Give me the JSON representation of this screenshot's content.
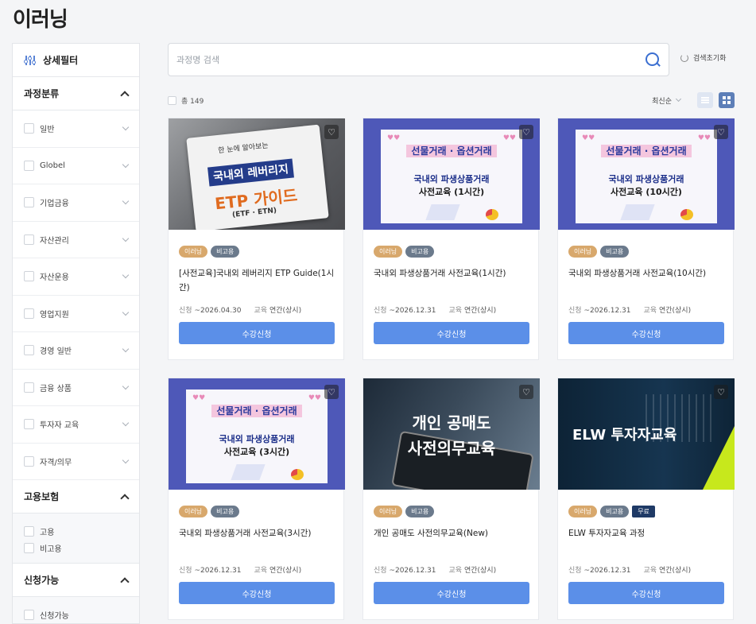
{
  "page": {
    "title": "이러닝"
  },
  "sidebar": {
    "header": "상세필터",
    "sections": [
      {
        "title": "과정분류",
        "items": [
          "일반",
          "Globel",
          "기업금융",
          "자산관리",
          "자산운용",
          "영업지원",
          "경영 일반",
          "금융 상품",
          "투자자 교육",
          "자격/의무"
        ]
      },
      {
        "title": "고용보험",
        "items": [
          "고용",
          "비고용"
        ]
      },
      {
        "title": "신청가능",
        "items": [
          "신청가능"
        ]
      }
    ]
  },
  "search": {
    "placeholder": "과정명 검색",
    "value": "",
    "reset_label": "검색초기화"
  },
  "toolbar": {
    "total_label": "총 149",
    "sort_label": "최신순"
  },
  "cards": [
    {
      "thumb": "etp",
      "thumb_text": [
        "한 눈에 알아보는",
        "국내외 레버리지",
        "ETP 가이드",
        "(ETF · ETN)"
      ],
      "badges": [
        "이러닝",
        "비고용"
      ],
      "title": "[사전교육]국내외 레버리지 ETP Guide(1시간)",
      "apply_label": "신청",
      "apply_period": "~2026.04.30",
      "edu_label": "교육",
      "edu_period": "연간(상시)",
      "button": "수강신청"
    },
    {
      "thumb": "deriv",
      "thumb_text": [
        "선물거래 · 옵션거래",
        "국내외 파생상품거래",
        "사전교육 (1시간)"
      ],
      "badges": [
        "이러닝",
        "비고용"
      ],
      "title": "국내외 파생상품거래 사전교육(1시간)",
      "apply_label": "신청",
      "apply_period": "~2026.12.31",
      "edu_label": "교육",
      "edu_period": "연간(상시)",
      "button": "수강신청"
    },
    {
      "thumb": "deriv",
      "thumb_text": [
        "선물거래 · 옵션거래",
        "국내외 파생상품거래",
        "사전교육 (10시간)"
      ],
      "badges": [
        "이러닝",
        "비고용"
      ],
      "title": "국내외 파생상품거래 사전교육(10시간)",
      "apply_label": "신청",
      "apply_period": "~2026.12.31",
      "edu_label": "교육",
      "edu_period": "연간(상시)",
      "button": "수강신청"
    },
    {
      "thumb": "deriv",
      "thumb_text": [
        "선물거래 · 옵션거래",
        "국내외 파생상품거래",
        "사전교육 (3시간)"
      ],
      "badges": [
        "이러닝",
        "비고용"
      ],
      "title": "국내외 파생상품거래 사전교육(3시간)",
      "apply_label": "신청",
      "apply_period": "~2026.12.31",
      "edu_label": "교육",
      "edu_period": "연간(상시)",
      "button": "수강신청"
    },
    {
      "thumb": "short",
      "thumb_text": [
        "개인 공매도",
        "사전의무교육"
      ],
      "badges": [
        "이러닝",
        "비고용"
      ],
      "title": "개인 공매도 사전의무교육(New)",
      "apply_label": "신청",
      "apply_period": "~2026.12.31",
      "edu_label": "교육",
      "edu_period": "연간(상시)",
      "button": "수강신청"
    },
    {
      "thumb": "elw",
      "thumb_text": [
        "ELW 투자자교육"
      ],
      "badges": [
        "이러닝",
        "비고용",
        "무료"
      ],
      "title": "ELW 투자자교육 과정",
      "apply_label": "신청",
      "apply_period": "~2026.12.31",
      "edu_label": "교육",
      "edu_period": "연간(상시)",
      "button": "수강신청"
    }
  ],
  "colors": {
    "accent": "#5b8fe8",
    "badge_elearning": "#d8a86c",
    "badge_nonemployment": "#6b7a8c",
    "badge_free": "#1f3a66"
  },
  "icons": {
    "filter": "filter-sliders-icon",
    "search": "search-icon",
    "reset": "refresh-icon",
    "heart": "heart-icon",
    "list": "list-view-icon",
    "grid": "grid-view-icon"
  }
}
